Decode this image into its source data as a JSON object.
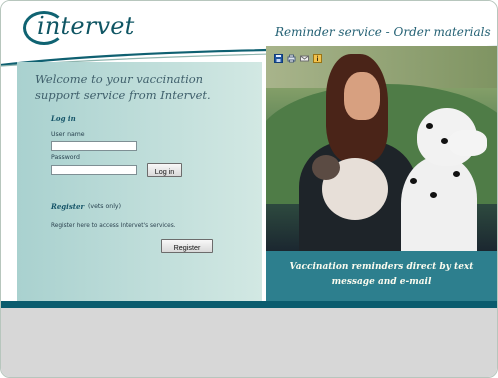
{
  "header": {
    "logo_text": "intervet",
    "tagline": "Reminder service - Order materials"
  },
  "main": {
    "welcome": "Welcome to your vaccination support service from Intervet.",
    "login": {
      "title": "Log in",
      "username_label": "User name",
      "username_value": "",
      "password_label": "Password",
      "password_value": "",
      "login_button": "Log in"
    },
    "register": {
      "title": "Register",
      "subtitle": "(vets only)",
      "description": "Register here to access Intervet's services.",
      "register_button": "Register"
    }
  },
  "hero": {
    "toolbar_icons": [
      "save-icon",
      "print-icon",
      "mail-icon",
      "info-icon"
    ],
    "banner_line1": "Vaccination reminders direct by text",
    "banner_line2": "message and e-mail"
  },
  "colors": {
    "teal_dark": "#0a5c6e",
    "teal_banner": "#2d7f8e",
    "panel_left": "#a9d1cf",
    "panel_right": "#d2e8e3"
  }
}
